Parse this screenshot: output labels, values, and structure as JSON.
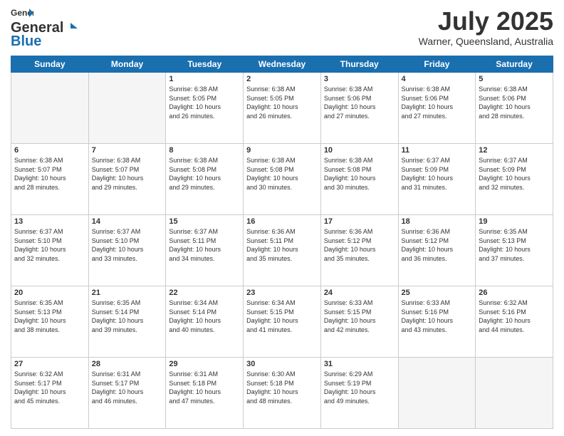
{
  "header": {
    "logo_general": "General",
    "logo_blue": "Blue",
    "month_title": "July 2025",
    "location": "Warner, Queensland, Australia"
  },
  "weekdays": [
    "Sunday",
    "Monday",
    "Tuesday",
    "Wednesday",
    "Thursday",
    "Friday",
    "Saturday"
  ],
  "weeks": [
    [
      {
        "day": "",
        "detail": ""
      },
      {
        "day": "",
        "detail": ""
      },
      {
        "day": "1",
        "detail": "Sunrise: 6:38 AM\nSunset: 5:05 PM\nDaylight: 10 hours\nand 26 minutes."
      },
      {
        "day": "2",
        "detail": "Sunrise: 6:38 AM\nSunset: 5:05 PM\nDaylight: 10 hours\nand 26 minutes."
      },
      {
        "day": "3",
        "detail": "Sunrise: 6:38 AM\nSunset: 5:06 PM\nDaylight: 10 hours\nand 27 minutes."
      },
      {
        "day": "4",
        "detail": "Sunrise: 6:38 AM\nSunset: 5:06 PM\nDaylight: 10 hours\nand 27 minutes."
      },
      {
        "day": "5",
        "detail": "Sunrise: 6:38 AM\nSunset: 5:06 PM\nDaylight: 10 hours\nand 28 minutes."
      }
    ],
    [
      {
        "day": "6",
        "detail": "Sunrise: 6:38 AM\nSunset: 5:07 PM\nDaylight: 10 hours\nand 28 minutes."
      },
      {
        "day": "7",
        "detail": "Sunrise: 6:38 AM\nSunset: 5:07 PM\nDaylight: 10 hours\nand 29 minutes."
      },
      {
        "day": "8",
        "detail": "Sunrise: 6:38 AM\nSunset: 5:08 PM\nDaylight: 10 hours\nand 29 minutes."
      },
      {
        "day": "9",
        "detail": "Sunrise: 6:38 AM\nSunset: 5:08 PM\nDaylight: 10 hours\nand 30 minutes."
      },
      {
        "day": "10",
        "detail": "Sunrise: 6:38 AM\nSunset: 5:08 PM\nDaylight: 10 hours\nand 30 minutes."
      },
      {
        "day": "11",
        "detail": "Sunrise: 6:37 AM\nSunset: 5:09 PM\nDaylight: 10 hours\nand 31 minutes."
      },
      {
        "day": "12",
        "detail": "Sunrise: 6:37 AM\nSunset: 5:09 PM\nDaylight: 10 hours\nand 32 minutes."
      }
    ],
    [
      {
        "day": "13",
        "detail": "Sunrise: 6:37 AM\nSunset: 5:10 PM\nDaylight: 10 hours\nand 32 minutes."
      },
      {
        "day": "14",
        "detail": "Sunrise: 6:37 AM\nSunset: 5:10 PM\nDaylight: 10 hours\nand 33 minutes."
      },
      {
        "day": "15",
        "detail": "Sunrise: 6:37 AM\nSunset: 5:11 PM\nDaylight: 10 hours\nand 34 minutes."
      },
      {
        "day": "16",
        "detail": "Sunrise: 6:36 AM\nSunset: 5:11 PM\nDaylight: 10 hours\nand 35 minutes."
      },
      {
        "day": "17",
        "detail": "Sunrise: 6:36 AM\nSunset: 5:12 PM\nDaylight: 10 hours\nand 35 minutes."
      },
      {
        "day": "18",
        "detail": "Sunrise: 6:36 AM\nSunset: 5:12 PM\nDaylight: 10 hours\nand 36 minutes."
      },
      {
        "day": "19",
        "detail": "Sunrise: 6:35 AM\nSunset: 5:13 PM\nDaylight: 10 hours\nand 37 minutes."
      }
    ],
    [
      {
        "day": "20",
        "detail": "Sunrise: 6:35 AM\nSunset: 5:13 PM\nDaylight: 10 hours\nand 38 minutes."
      },
      {
        "day": "21",
        "detail": "Sunrise: 6:35 AM\nSunset: 5:14 PM\nDaylight: 10 hours\nand 39 minutes."
      },
      {
        "day": "22",
        "detail": "Sunrise: 6:34 AM\nSunset: 5:14 PM\nDaylight: 10 hours\nand 40 minutes."
      },
      {
        "day": "23",
        "detail": "Sunrise: 6:34 AM\nSunset: 5:15 PM\nDaylight: 10 hours\nand 41 minutes."
      },
      {
        "day": "24",
        "detail": "Sunrise: 6:33 AM\nSunset: 5:15 PM\nDaylight: 10 hours\nand 42 minutes."
      },
      {
        "day": "25",
        "detail": "Sunrise: 6:33 AM\nSunset: 5:16 PM\nDaylight: 10 hours\nand 43 minutes."
      },
      {
        "day": "26",
        "detail": "Sunrise: 6:32 AM\nSunset: 5:16 PM\nDaylight: 10 hours\nand 44 minutes."
      }
    ],
    [
      {
        "day": "27",
        "detail": "Sunrise: 6:32 AM\nSunset: 5:17 PM\nDaylight: 10 hours\nand 45 minutes."
      },
      {
        "day": "28",
        "detail": "Sunrise: 6:31 AM\nSunset: 5:17 PM\nDaylight: 10 hours\nand 46 minutes."
      },
      {
        "day": "29",
        "detail": "Sunrise: 6:31 AM\nSunset: 5:18 PM\nDaylight: 10 hours\nand 47 minutes."
      },
      {
        "day": "30",
        "detail": "Sunrise: 6:30 AM\nSunset: 5:18 PM\nDaylight: 10 hours\nand 48 minutes."
      },
      {
        "day": "31",
        "detail": "Sunrise: 6:29 AM\nSunset: 5:19 PM\nDaylight: 10 hours\nand 49 minutes."
      },
      {
        "day": "",
        "detail": ""
      },
      {
        "day": "",
        "detail": ""
      }
    ]
  ]
}
